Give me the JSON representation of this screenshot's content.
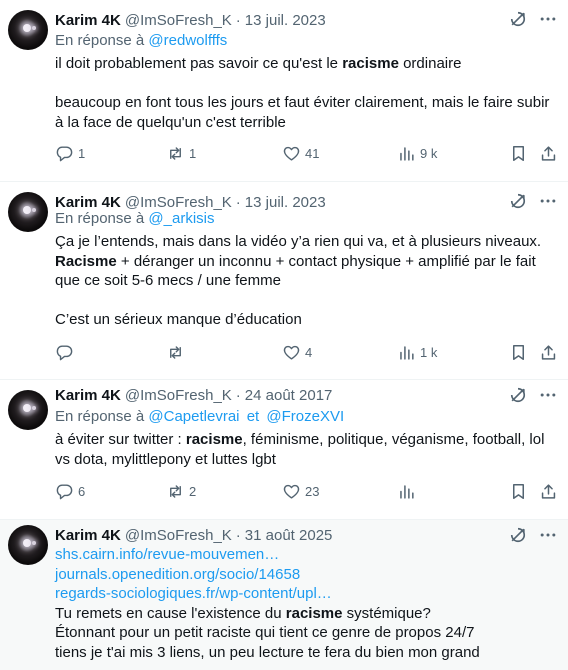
{
  "tweets": [
    {
      "name": "Karim 4K",
      "handle": "@ImSoFresh_K",
      "date": "13 juil. 2023",
      "reply_prefix": "En réponse à",
      "reply_to": [
        "@redwolfffs"
      ],
      "text_lines": [
        [
          "il doit probablement pas savoir ce qu'est le ",
          "racisme",
          " ordinaire"
        ],
        [
          "beaucoup en font tous les jours et faut éviter clairement, mais le faire subir à la face de quelqu'un c'est terrible"
        ]
      ],
      "stats": {
        "replies": "1",
        "reposts": "1",
        "likes": "41",
        "views": "9 k"
      }
    },
    {
      "name": "Karim 4K",
      "handle": "@ImSoFresh_K",
      "date": "13 juil. 2023",
      "reply_prefix": "En réponse à",
      "reply_to": [
        "@_arkisis"
      ],
      "text_lines": [
        [
          "Ça je l’entends, mais dans la vidéo y’a rien qui va, et à plusieurs niveaux."
        ],
        [
          "Racisme",
          " + déranger un inconnu + contact physique + amplifié par le fait que ce soit 5-6 mecs / une femme"
        ],
        [
          "C’est un sérieux manque d’éducation"
        ]
      ],
      "stats": {
        "replies": "",
        "reposts": "",
        "likes": "4",
        "views": "1 k"
      }
    },
    {
      "name": "Karim 4K",
      "handle": "@ImSoFresh_K",
      "date": "24 août 2017",
      "reply_prefix": "En réponse à",
      "reply_to": [
        "@Capetlevrai",
        "@FrozeXVI"
      ],
      "reply_joiner": "et",
      "text_lines": [
        [
          "à éviter sur twitter : ",
          "racisme",
          ", féminisme, politique, véganisme, football, lol vs dota, mylittlepony et luttes lgbt"
        ]
      ],
      "stats": {
        "replies": "6",
        "reposts": "2",
        "likes": "23",
        "views": ""
      }
    },
    {
      "name": "Karim 4K",
      "handle": "@ImSoFresh_K",
      "date": "31 août 2025",
      "links": [
        "shs.cairn.info/revue-mouvemen…",
        "journals.openedition.org/socio/14658",
        "regards-sociologiques.fr/wp-content/upl…"
      ],
      "text_lines": [
        [
          "Tu remets en cause l'existence du ",
          "racisme",
          " systémique?"
        ],
        [
          "Étonnant pour un petit raciste qui tient ce genre de propos 24/7"
        ],
        [
          "tiens je t'ai mis 3 liens, un peu lecture te fera du bien mon grand"
        ]
      ]
    }
  ],
  "icons": {
    "reply": "reply-icon",
    "repost": "repost-icon",
    "like": "heart-icon",
    "views": "views-icon",
    "bookmark": "bookmark-icon",
    "share": "share-icon",
    "grok": "grok-icon",
    "more": "more-icon"
  },
  "colors": {
    "text": "#0f1419",
    "secondary": "#536471",
    "link": "#1d9bf0",
    "border": "#eff3f4",
    "highlight_bg": "#f7f9f9"
  }
}
